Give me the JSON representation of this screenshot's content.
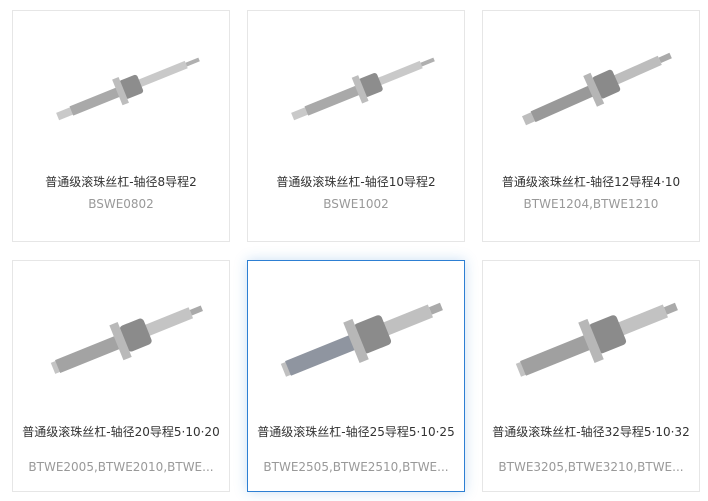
{
  "products": [
    {
      "title": "普通级滚珠丝杠-轴径8导程2",
      "models": "BSWE0802"
    },
    {
      "title": "普通级滚珠丝杠-轴径10导程2",
      "models": "BSWE1002"
    },
    {
      "title": "普通级滚珠丝杠-轴径12导程4·10",
      "models": "BTWE1204,BTWE1210"
    },
    {
      "title": "普通级滚珠丝杠-轴径20导程5·10·20",
      "models": "BTWE2005,BTWE2010,BTWE..."
    },
    {
      "title": "普通级滚珠丝杠-轴径25导程5·10·25",
      "models": "BTWE2505,BTWE2510,BTWE..."
    },
    {
      "title": "普通级滚珠丝杠-轴径32导程5·10·32",
      "models": "BTWE3205,BTWE3210,BTWE..."
    }
  ]
}
